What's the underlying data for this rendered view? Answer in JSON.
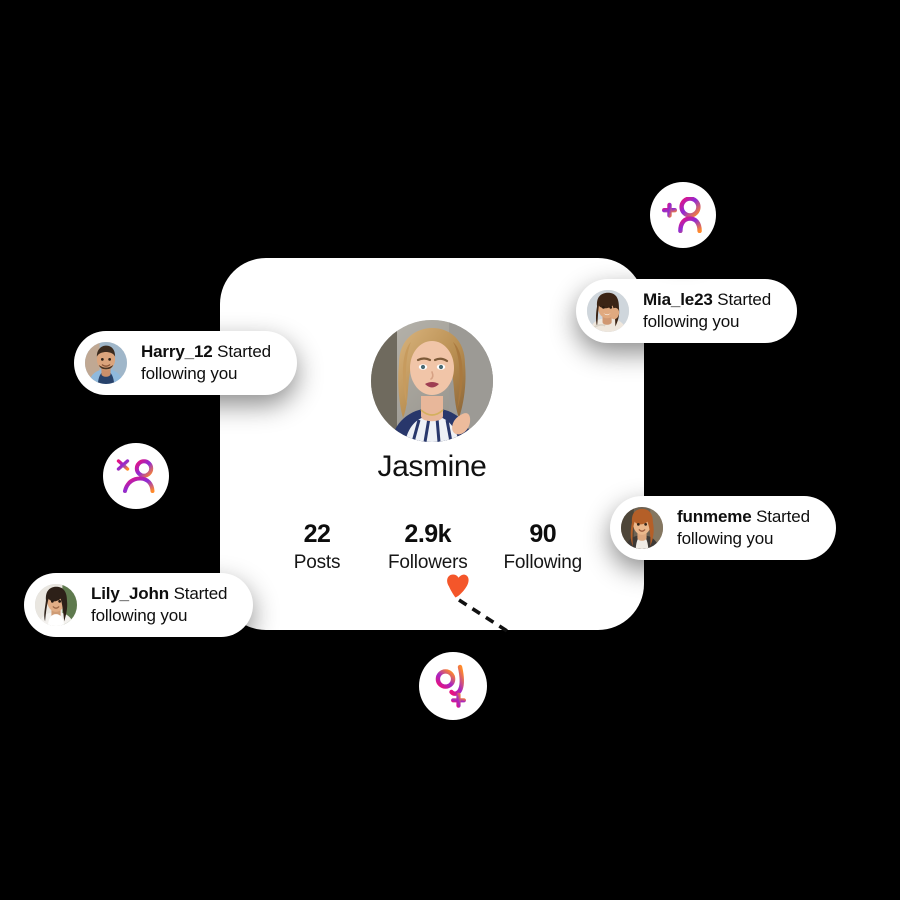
{
  "background_color": "#000000",
  "card_color": "#ffffff",
  "accent_gradient": {
    "from": "#e8117f",
    "via": "#9b27d6",
    "to": "#ff8a2a"
  },
  "cursor_color": "#f4562a",
  "profile": {
    "name": "Jasmine",
    "avatar_name": "profile-photo-jasmine",
    "stats": [
      {
        "value": "22",
        "label": "Posts"
      },
      {
        "value": "2.9k",
        "label": "Followers"
      },
      {
        "value": "90",
        "label": "Following"
      }
    ]
  },
  "notifications": [
    {
      "id": "harry",
      "username": "Harry_12",
      "action": "Started",
      "action_line2": "following you",
      "avatar_name": "avatar-harry-12"
    },
    {
      "id": "mia",
      "username": "Mia_le23",
      "action": "Started",
      "action_line2": "following you",
      "avatar_name": "avatar-mia-le23"
    },
    {
      "id": "funmeme",
      "username": "funmeme",
      "action": "Started",
      "action_line2": "following you",
      "avatar_name": "avatar-funmeme"
    },
    {
      "id": "lily",
      "username": "Lily_John",
      "action": "Started",
      "action_line2": "following you",
      "avatar_name": "avatar-lily-john"
    }
  ],
  "badges": [
    {
      "id": "add-user",
      "icon": "add-user-icon"
    },
    {
      "id": "user-sparkle",
      "icon": "user-sparkle-icon"
    },
    {
      "id": "add-person",
      "icon": "add-person-icon"
    }
  ],
  "cursor": {
    "icon": "heart-cursor-icon",
    "trail": "dashed-line"
  }
}
